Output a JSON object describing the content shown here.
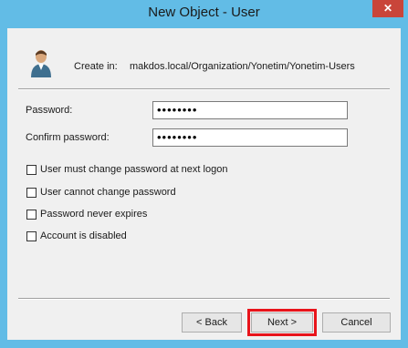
{
  "window": {
    "title": "New Object - User",
    "close_label": "✕"
  },
  "create_in": {
    "label": "Create in:",
    "path": "makdos.local/Organization/Yonetim/Yonetim-Users"
  },
  "fields": {
    "password_label": "Password:",
    "password_value": "••••••••",
    "confirm_label": "Confirm password:",
    "confirm_value": "••••••••"
  },
  "options": [
    {
      "label": "User must change password at next logon",
      "checked": false
    },
    {
      "label": "User cannot change password",
      "checked": false
    },
    {
      "label": "Password never expires",
      "checked": false
    },
    {
      "label": "Account is disabled",
      "checked": false
    }
  ],
  "buttons": {
    "back": "< Back",
    "next": "Next >",
    "cancel": "Cancel"
  },
  "colors": {
    "frame": "#62bce6",
    "highlight": "#e8141b"
  }
}
